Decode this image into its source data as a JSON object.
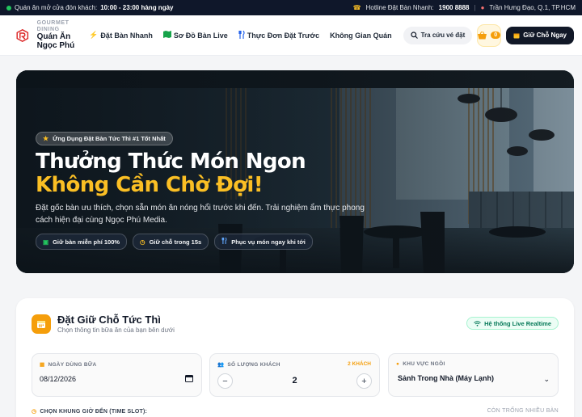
{
  "topbar": {
    "hours_prefix": "Quán ăn mở cửa đón khách:",
    "hours_value": "10:00 - 23:00 hàng ngày",
    "hotline_prefix": "Hotline Đặt Bàn Nhanh:",
    "hotline_value": "1900 8888",
    "separator": "|",
    "address": "Trần Hưng Đạo, Q.1, TP.HCM"
  },
  "header": {
    "brand_small": "GOURMET DINING",
    "brand_name": "Quán Ăn Ngọc Phú",
    "nav": [
      {
        "label": "Đặt Bàn Nhanh",
        "icon": "bolt-icon"
      },
      {
        "label": "Sơ Đồ Bàn Live",
        "icon": "map-icon"
      },
      {
        "label": "Thực Đơn Đặt Trước",
        "icon": "fork-knife-icon"
      },
      {
        "label": "Không Gian Quán",
        "icon": ""
      }
    ],
    "search_label": "Tra cứu vé đặt",
    "cart_count": "0",
    "reserve_label": "Giữ Chỗ Ngay"
  },
  "hero": {
    "tag": "Ứng Dụng Đặt Bàn Tức Thì #1 Tốt Nhất",
    "title_line1": "Thưởng Thức Món Ngon",
    "title_line2": "Không Cần Chờ Đợi!",
    "subtitle": "Đặt gốc bàn ưu thích, chọn sẵn món ăn nóng hổi trước khi đến. Trải nghiệm ẩm thực phong cách hiện đại cùng Ngọc Phú Media.",
    "chips": [
      {
        "label": "Giữ bàn miễn phí 100%"
      },
      {
        "label": "Giữ chỗ trong 15s"
      },
      {
        "label": "Phục vụ món ngay khi tới"
      }
    ]
  },
  "booking": {
    "title": "Đặt Giữ Chỗ Tức Thì",
    "subtitle": "Chọn thông tin bữa ăn của bạn bên dưới",
    "live_badge": "Hệ thống Live Realtime",
    "date_label": "NGÀY DÙNG BỮA",
    "date_value": "08/12/2026",
    "guests_label": "SỐ LƯỢNG KHÁCH",
    "guests_summary": "2 KHÁCH",
    "guests_value": "2",
    "minus": "−",
    "plus": "+",
    "area_label": "KHU VỰC NGỒI",
    "area_value": "Sảnh Trong Nhà (Máy Lạnh)",
    "slot_label": "CHỌN KHUNG GIỜ ĐẾN (TIME SLOT):",
    "slot_status": "CÒN TRỐNG NHIỀU BÀN"
  },
  "colors": {
    "accent": "#f59e0b",
    "dark": "#111827",
    "live_green": "#047857"
  }
}
